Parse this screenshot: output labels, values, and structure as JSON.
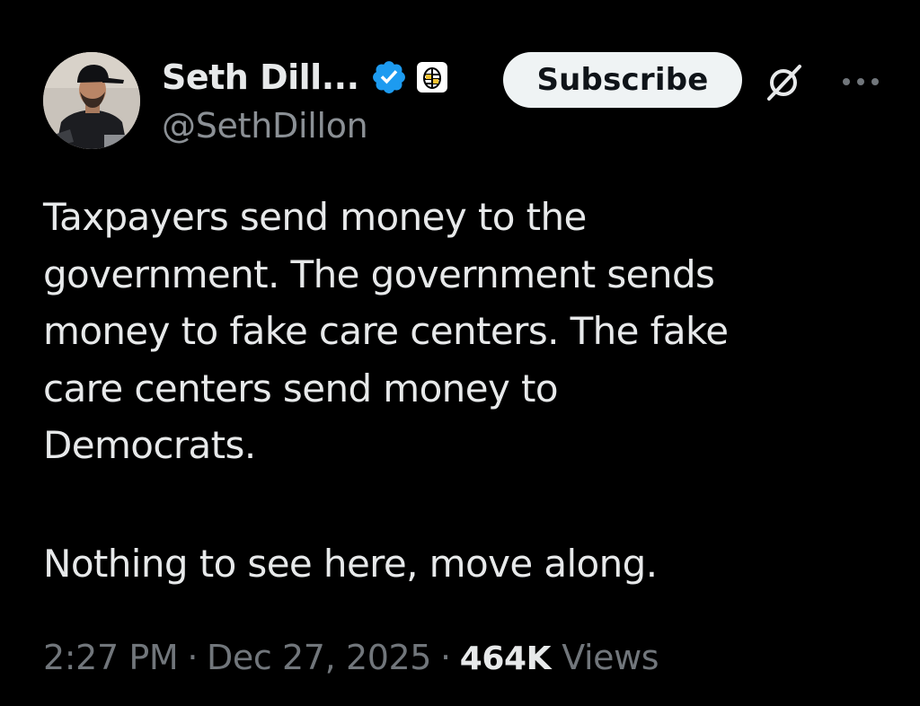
{
  "author": {
    "display_name": "Seth Dill...",
    "handle": "@SethDillon",
    "verified_icon": "verified-badge-icon",
    "org_icon": "babylon-bee-affiliate-icon"
  },
  "actions": {
    "subscribe_label": "Subscribe",
    "grok_icon": "grok-icon",
    "more_icon": "more-options-icon"
  },
  "tweet": {
    "text": "Taxpayers send money to the\ngovernment. The government sends\nmoney to fake care centers. The fake\ncare centers send money to\nDemocrats.",
    "text2": "Nothing to see here, move along."
  },
  "meta": {
    "time": "2:27 PM",
    "separator": "·",
    "date": "Dec 27, 2025",
    "views_count": "464K",
    "views_label": "Views"
  },
  "colors": {
    "background": "#000000",
    "text": "#e7e9ea",
    "muted": "#71767b",
    "verified_blue": "#1d9bf0",
    "subscribe_bg": "#eff3f4"
  }
}
